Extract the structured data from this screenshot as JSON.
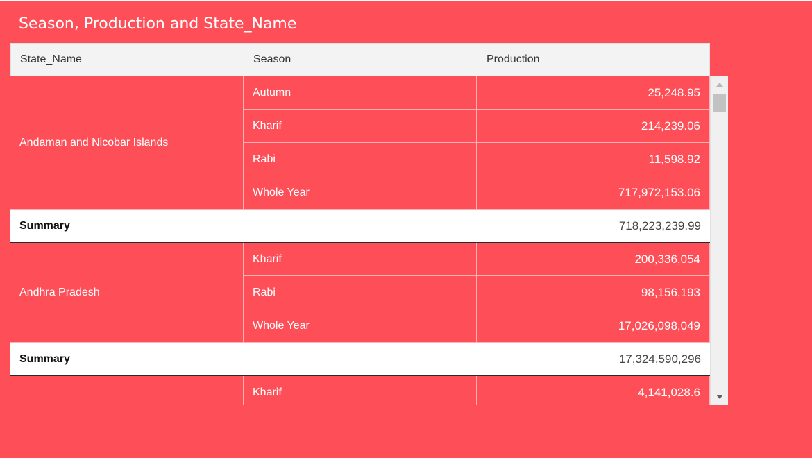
{
  "widget": {
    "title": "Season, Production and State_Name",
    "accent_color": "#fe4f58"
  },
  "table": {
    "columns": [
      "State_Name",
      "Season",
      "Production"
    ],
    "groups": [
      {
        "state": "Andaman and Nicobar Islands",
        "rows": [
          {
            "season": "Autumn",
            "production": "25,248.95"
          },
          {
            "season": "Kharif",
            "production": "214,239.06"
          },
          {
            "season": "Rabi",
            "production": "11,598.92"
          },
          {
            "season": "Whole Year",
            "production": "717,972,153.06"
          }
        ],
        "summary_label": "Summary",
        "summary_value": "718,223,239.99"
      },
      {
        "state": "Andhra Pradesh",
        "rows": [
          {
            "season": "Kharif",
            "production": "200,336,054"
          },
          {
            "season": "Rabi",
            "production": "98,156,193"
          },
          {
            "season": "Whole Year",
            "production": "17,026,098,049"
          }
        ],
        "summary_label": "Summary",
        "summary_value": "17,324,590,296"
      },
      {
        "state": "",
        "rows": [
          {
            "season": "Kharif",
            "production": "4,141,028.6"
          }
        ]
      }
    ]
  },
  "scrollbar": {
    "up_icon": "triangle-up-icon",
    "down_icon": "triangle-down-icon"
  }
}
